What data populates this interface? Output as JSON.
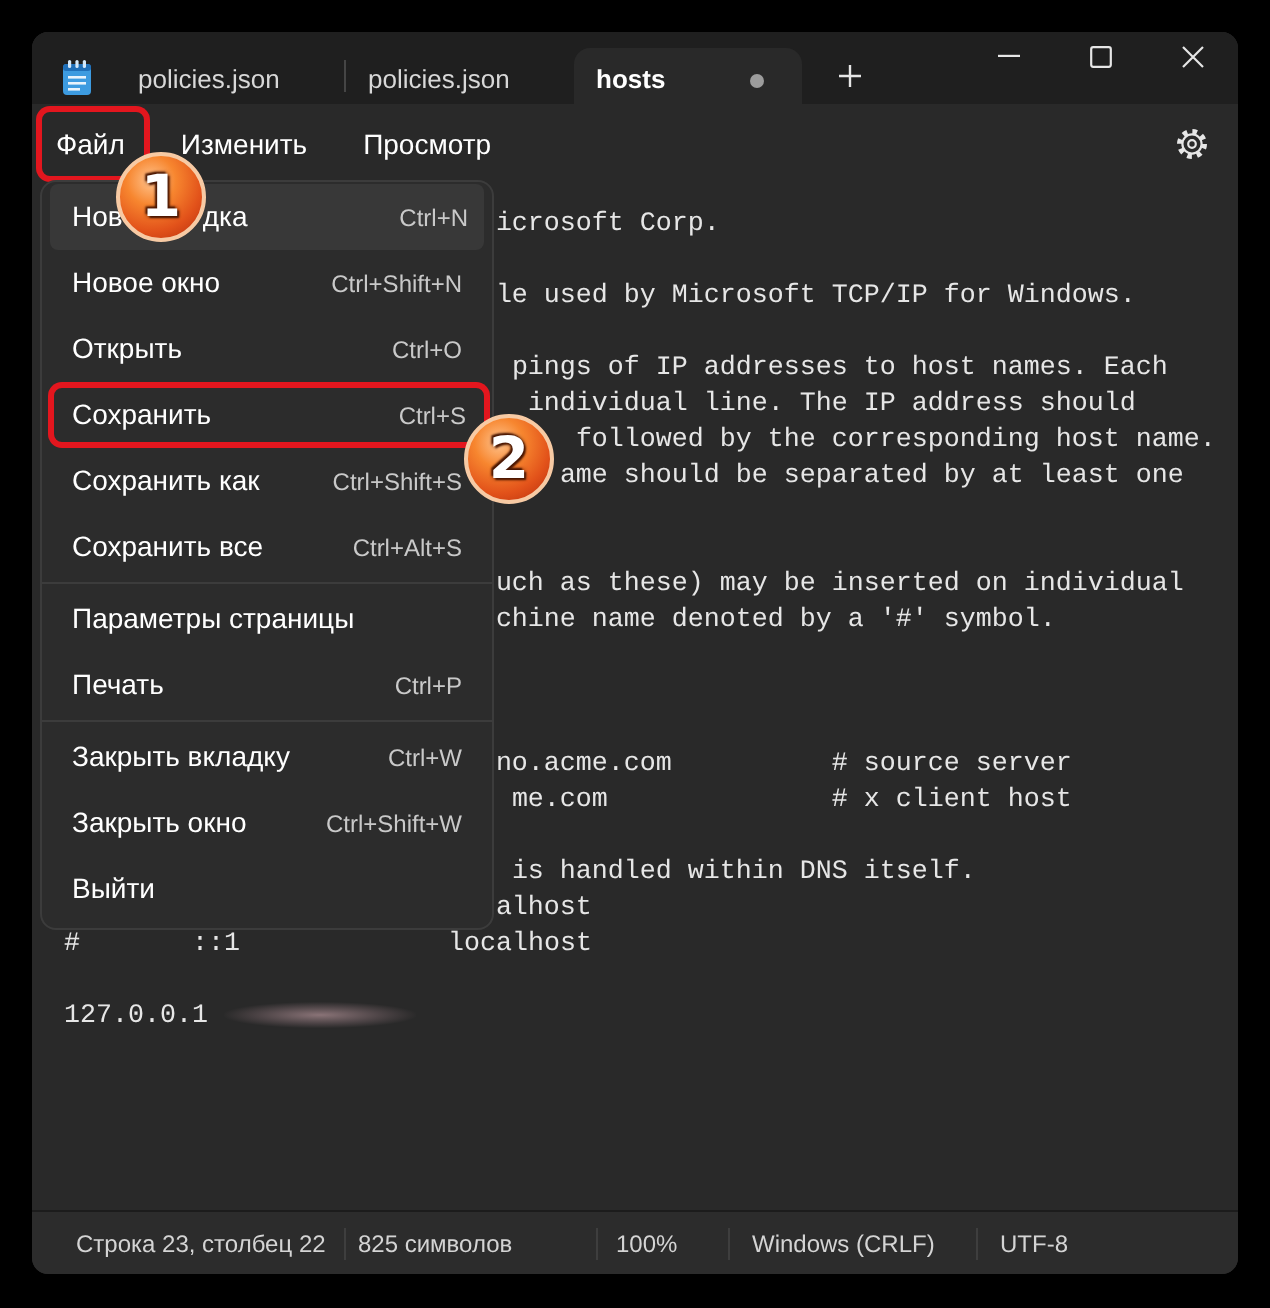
{
  "tabs": [
    {
      "title": "policies.json",
      "selected": false,
      "modified": false
    },
    {
      "title": "policies.json",
      "selected": false,
      "modified": false
    },
    {
      "title": "hosts",
      "selected": true,
      "modified": true
    }
  ],
  "menu_bar": [
    {
      "label": "Файл",
      "outlined": true
    },
    {
      "label": "Изменить",
      "outlined": false
    },
    {
      "label": "Просмотр",
      "outlined": false
    }
  ],
  "file_menu": {
    "groups": [
      [
        {
          "label": "Нов",
          "label_tail": "дка",
          "shortcut": "Ctrl+N",
          "highlighted": true,
          "outlined": false
        },
        {
          "label": "Новое окно",
          "shortcut": "Ctrl+Shift+N",
          "highlighted": false,
          "outlined": false
        },
        {
          "label": "Открыть",
          "shortcut": "Ctrl+O",
          "highlighted": false,
          "outlined": false
        },
        {
          "label": "Сохранить",
          "shortcut": "Ctrl+S",
          "highlighted": false,
          "outlined": true
        },
        {
          "label": "Сохранить как",
          "shortcut": "Ctrl+Shift+S",
          "highlighted": false,
          "outlined": false
        },
        {
          "label": "Сохранить все",
          "shortcut": "Ctrl+Alt+S",
          "highlighted": false,
          "outlined": false
        }
      ],
      [
        {
          "label": "Параметры страницы",
          "highlighted": false,
          "outlined": false
        },
        {
          "label": "Печать",
          "shortcut": "Ctrl+P",
          "highlighted": false,
          "outlined": false
        }
      ],
      [
        {
          "label": "Закрыть вкладку",
          "shortcut": "Ctrl+W",
          "highlighted": false,
          "outlined": false
        },
        {
          "label": "Закрыть окно",
          "shortcut": "Ctrl+Shift+W",
          "highlighted": false,
          "outlined": false
        },
        {
          "label": "Выйти",
          "highlighted": false,
          "outlined": false
        }
      ]
    ]
  },
  "editor": {
    "lines": [
      {
        "segments": [
          "icrosoft Corp."
        ]
      },
      {
        "segments": [
          "le used by Microsoft TCP/IP for Windows."
        ]
      },
      {
        "segments": [
          "pings of IP addresses to host names. Each"
        ]
      },
      {
        "segments": [
          "individual line. The IP address should"
        ]
      },
      {
        "segments": [
          "followed by the corresponding host name."
        ]
      },
      {
        "segments": [
          "ame should be separated by at least one"
        ]
      },
      {
        "segments": [
          "uch as these) may be inserted on individual"
        ]
      },
      {
        "segments": [
          "chine name denoted by a '#' symbol."
        ]
      },
      {
        "segments": [
          "no.acme.com",
          "# source server"
        ]
      },
      {
        "segments": [
          "me.com",
          "# x client host"
        ]
      },
      {
        "segments": [
          "is handled within DNS itself."
        ]
      },
      {
        "segments": [
          "alhost"
        ]
      },
      {
        "segments": [
          "#",
          "::1",
          "localhost"
        ]
      },
      {
        "segments": [
          "127.0.0.1"
        ],
        "blurred": true
      }
    ]
  },
  "status_bar": [
    "Строка 23, столбец 22",
    "825 символов",
    "100%",
    "Windows (CRLF)",
    "UTF-8"
  ],
  "callouts": [
    {
      "number": "1"
    },
    {
      "number": "2"
    }
  ]
}
